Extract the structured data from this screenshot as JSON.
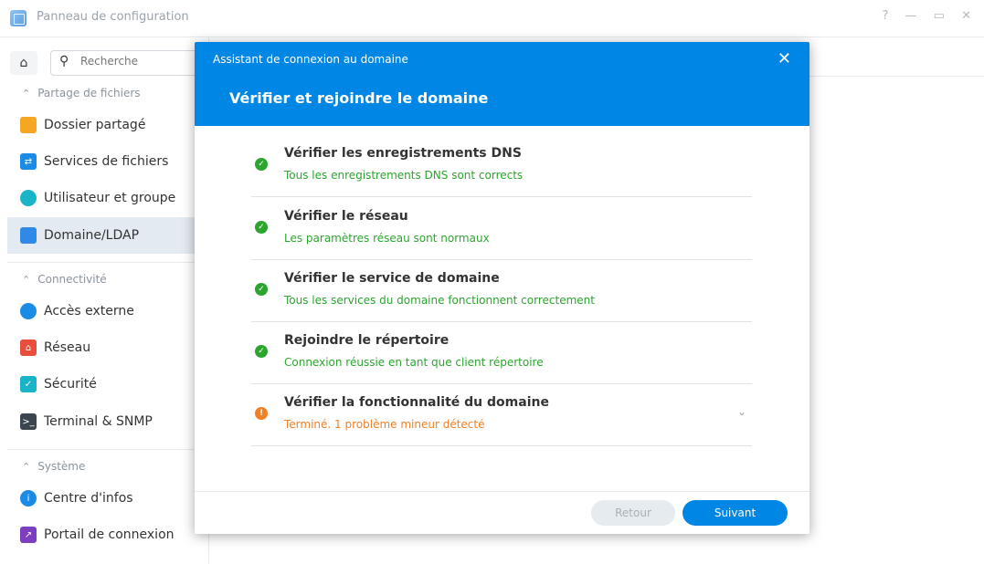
{
  "window": {
    "title": "Panneau de configuration",
    "controls": [
      "?",
      "—",
      "▭",
      "✕"
    ]
  },
  "sidebar": {
    "search_placeholder": "Recherche",
    "sections": [
      {
        "label": "Partage de fichiers"
      },
      {
        "label": "Connectivité"
      },
      {
        "label": "Système"
      }
    ],
    "items": [
      {
        "label": "Dossier partagé",
        "icon": "folder-icon",
        "color": "#f5a623"
      },
      {
        "label": "Services de fichiers",
        "icon": "file-services-icon",
        "color": "#1b8ce6"
      },
      {
        "label": "Utilisateur et groupe",
        "icon": "users-icon",
        "color": "#1ab4c9"
      },
      {
        "label": "Domaine/LDAP",
        "icon": "domain-icon",
        "color": "#2e8ae6",
        "active": true
      },
      {
        "label": "Accès externe",
        "icon": "external-access-icon",
        "color": "#1b8ce6"
      },
      {
        "label": "Réseau",
        "icon": "network-icon",
        "color": "#e94e3c"
      },
      {
        "label": "Sécurité",
        "icon": "security-icon",
        "color": "#1ab4c9"
      },
      {
        "label": "Terminal & SNMP",
        "icon": "terminal-icon",
        "color": "#3a4550"
      },
      {
        "label": "Centre d'infos",
        "icon": "info-icon",
        "color": "#1b8ce6"
      },
      {
        "label": "Portail de connexion",
        "icon": "login-portal-icon",
        "color": "#7b3fbf"
      }
    ]
  },
  "dialog": {
    "app_title": "Assistant de connexion au domaine",
    "title": "Vérifier et rejoindre le domaine",
    "steps": [
      {
        "title": "Vérifier les enregistrements DNS",
        "status": "Tous les enregistrements DNS sont corrects",
        "state": "ok"
      },
      {
        "title": "Vérifier le réseau",
        "status": "Les paramètres réseau sont normaux",
        "state": "ok"
      },
      {
        "title": "Vérifier le service de domaine",
        "status": "Tous les services du domaine fonctionnent correctement",
        "state": "ok"
      },
      {
        "title": "Rejoindre le répertoire",
        "status": "Connexion réussie en tant que client répertoire",
        "state": "ok"
      },
      {
        "title": "Vérifier la fonctionnalité du domaine",
        "status": "Terminé. 1 problème mineur détecté",
        "state": "warn"
      }
    ],
    "back_label": "Retour",
    "next_label": "Suivant"
  },
  "colors": {
    "accent": "#0086e5",
    "success": "#2ba52d",
    "warning": "#f28025"
  }
}
